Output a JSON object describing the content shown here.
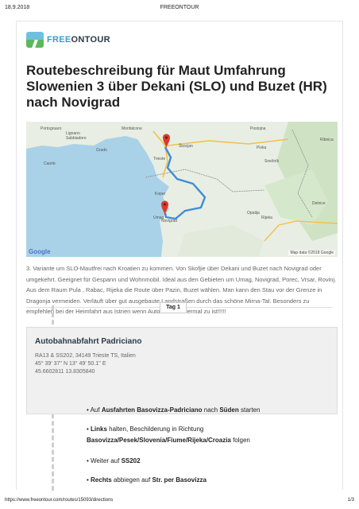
{
  "print_header": {
    "date": "18.9.2018",
    "site": "FREEONTOUR"
  },
  "logo": {
    "part1": "FREE",
    "part2": "ONTOUR"
  },
  "title": "Routebeschreibung für Maut Umfahrung Slowenien 3 über Dekani (SLO) und Buzet (HR) nach Novigrad",
  "map": {
    "labels": {
      "monfalcone": "Monfalcone",
      "portogruaro": "Portogruaro",
      "lignano": "Lignano\nSabbiadoro",
      "grado": "Grado",
      "caorle": "Caorle",
      "trieste": "Trieste",
      "koper": "Koper",
      "umag": "Umag",
      "novigrad": "Novigrad",
      "postojna": "Postojna",
      "skocjan": "Škocjan",
      "pivka": "Pivka",
      "ribnica": "Ribnica",
      "snezník": "Snežník",
      "rijeka": "Rijeka",
      "opatija": "Opatija",
      "delnice": "Delnice"
    },
    "google": "Google",
    "copyright": "Map data ©2018 Google",
    "colors": {
      "water": "#a9d2e8",
      "land": "#e8eee3",
      "route": "#3d8bd9",
      "pin": "#d93b2e"
    }
  },
  "description": "3. Variante um SLO-Mautfrei nach Kroatien zu kommen. Von Skofjie über Dekani und Buzet nach Novigrad oder umgekehrt. Geeignet für Gespann und Wohnmobil. Ideal aus den Gebieten um Umag, Novigrad, Porec, Vrsar, Rovinj. Aus dem Raum Pula , Rabac, Rijeka die Route über Pazin, Buzet wählen. Man kann den Stau vor der Grenze in Dragonja vermeiden. Verläuft über gut ausgebaute Landstraßen durch das schöne Mirna-Tal. Besonders zu empfehlen bei der Heimfahrt aus Istrien wenn Autobahn wiedermal zu ist!!!!!",
  "day_badge": "Tag 1",
  "stop": {
    "title": "Autobahnabfahrt Padriciano",
    "address": "RA13 & SS202, 34149 Trieste TS, Italien",
    "dms": "45° 39' 37'' N 13° 49' 50.1'' E",
    "decimal": "45.6602811 13.8305840"
  },
  "steps": [
    {
      "pre": "• Auf ",
      "b1": "Ausfahrten Basovizza-Padriciano",
      "mid": " nach ",
      "b2": "Süden",
      "post": " starten"
    },
    {
      "pre": "• ",
      "b1": "Links",
      "mid": " halten, Beschilderung in Richtung",
      "b2": "Basovizza/Pesek/Slovenia/Fiume/Rijeka/Croazia",
      "post": " folgen"
    },
    {
      "pre": "• Weiter auf ",
      "b1": "SS202",
      "mid": "",
      "b2": "",
      "post": ""
    },
    {
      "pre": "• ",
      "b1": "Rechts",
      "mid": " abbiegen auf ",
      "b2": "Str. per Basovizza",
      "post": ""
    }
  ],
  "print_footer": {
    "url": "https://www.freeontour.com/routes/15093/directions",
    "page": "1/3"
  }
}
